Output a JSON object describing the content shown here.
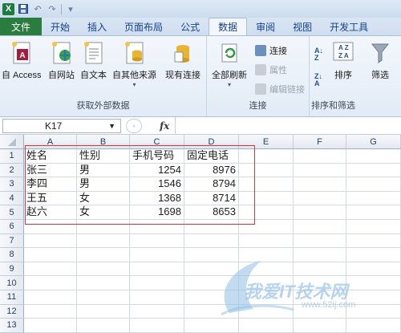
{
  "qat": {
    "logo": "X",
    "undo": "↶",
    "redo": "↷",
    "more": "▾"
  },
  "tabs": [
    "文件",
    "开始",
    "插入",
    "页面布局",
    "公式",
    "数据",
    "审阅",
    "视图",
    "开发工具"
  ],
  "ribbon": {
    "get_external": {
      "label": "获取外部数据",
      "buttons": [
        "自 Access",
        "自网站",
        "自文本",
        "自其他来源",
        "现有连接"
      ]
    },
    "connections": {
      "label": "连接",
      "refresh": "全部刷新",
      "small": [
        "连接",
        "属性",
        "编辑链接"
      ]
    },
    "sort": {
      "label": "排序和筛选",
      "sort": "排序",
      "filter": "筛选"
    }
  },
  "formula_bar": {
    "namebox": "K17",
    "fx": "fx",
    "value": ""
  },
  "columns": [
    "A",
    "B",
    "C",
    "D",
    "E",
    "F",
    "G"
  ],
  "rows": [
    "1",
    "2",
    "3",
    "4",
    "5",
    "6",
    "7",
    "8",
    "9",
    "10",
    "11",
    "12",
    "13"
  ],
  "cells": [
    [
      "姓名",
      "性别",
      "手机号码",
      "固定电话"
    ],
    [
      "张三",
      "男",
      "1254",
      "8976"
    ],
    [
      "李四",
      "男",
      "1546",
      "8794"
    ],
    [
      "王五",
      "女",
      "1368",
      "8714"
    ],
    [
      "赵六",
      "女",
      "1698",
      "8653"
    ]
  ],
  "watermark": {
    "cn": "我爱IT技术网",
    "url": "www.52ij.com"
  }
}
